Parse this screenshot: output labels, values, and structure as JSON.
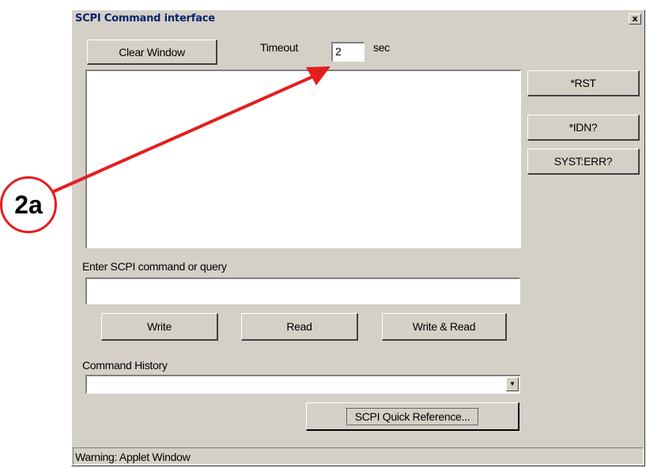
{
  "window": {
    "title": "SCPI Command interface",
    "close_label": "x"
  },
  "toolbar": {
    "clear_label": "Clear Window",
    "timeout_label": "Timeout",
    "timeout_value": "2",
    "timeout_unit": "sec"
  },
  "side_buttons": {
    "rst_label": "*RST",
    "idn_label": "*IDN?",
    "syst_err_label": "SYST:ERR?"
  },
  "command": {
    "prompt_label": "Enter SCPI command or query",
    "input_value": ""
  },
  "actions": {
    "write_label": "Write",
    "read_label": "Read",
    "write_read_label": "Write & Read"
  },
  "history": {
    "label": "Command History",
    "selected_value": ""
  },
  "quick_ref": {
    "label": "SCPI Quick Reference..."
  },
  "status": {
    "text": "Warning: Applet Window"
  },
  "annotation": {
    "callout_label": "2a",
    "color": "#e41e1e"
  }
}
